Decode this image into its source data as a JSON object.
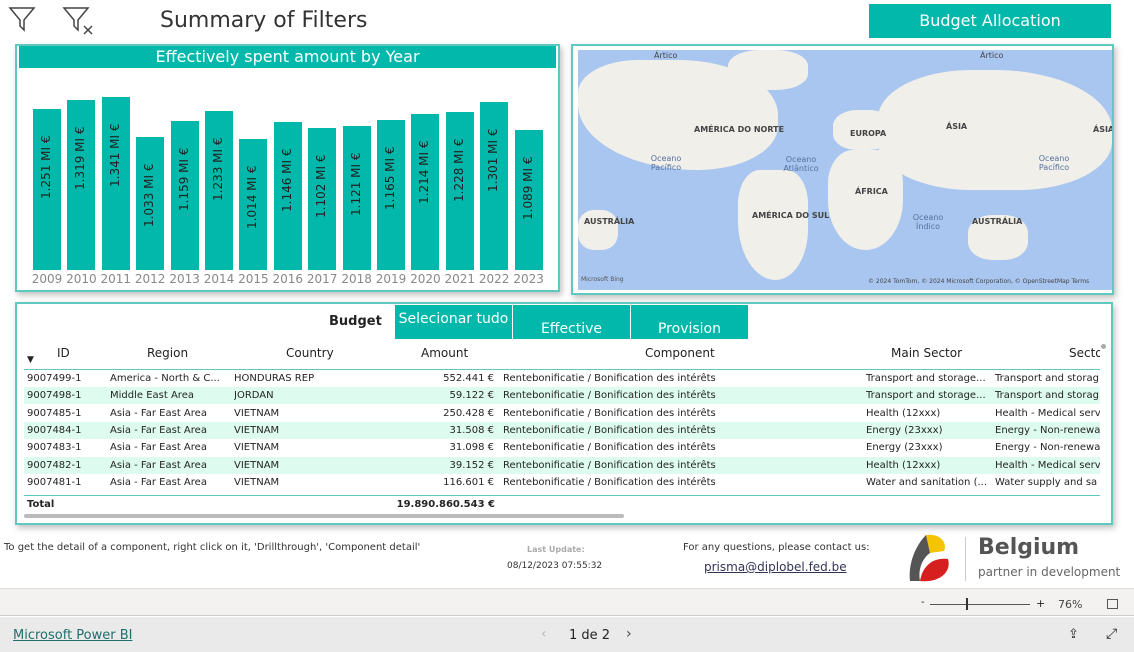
{
  "header": {
    "title": "Summary of Filters",
    "budget_allocation": "Budget Allocation",
    "filter_icon": "filter-icon",
    "clear_filter_icon": "clear-filter-icon"
  },
  "chart_data": {
    "type": "bar",
    "title": "Effectively spent amount by Year",
    "categories": [
      "2009",
      "2010",
      "2011",
      "2012",
      "2013",
      "2014",
      "2015",
      "2016",
      "2017",
      "2018",
      "2019",
      "2020",
      "2021",
      "2022",
      "2023"
    ],
    "values": [
      1.251,
      1.319,
      1.341,
      1.033,
      1.159,
      1.233,
      1.014,
      1.146,
      1.102,
      1.121,
      1.165,
      1.214,
      1.228,
      1.301,
      1.089
    ],
    "labels": [
      "1.251 MI €",
      "1.319 MI €",
      "1.341 MI €",
      "1.033 MI €",
      "1.159 MI €",
      "1.233 MI €",
      "1.014 MI €",
      "1.146 MI €",
      "1.102 MI €",
      "1.121 MI €",
      "1.165 MI €",
      "1.214 MI €",
      "1.228 MI €",
      "1.301 MI €",
      "1.089 MI €"
    ],
    "ylim": [
      0,
      1.35
    ],
    "color": "#01b8aa"
  },
  "map": {
    "labels": {
      "artico1": "Ártico",
      "artico2": "Ártico",
      "na": "AMÉRICA DO NORTE",
      "eu": "EUROPA",
      "asia1": "ÁSIA",
      "asia2": "ÁSIA",
      "af": "ÁFRICA",
      "sa": "AMÉRICA DO SUL",
      "au1": "AUSTRÁLIA",
      "au2": "AUSTRÁLIA",
      "pac1": "Oceano Pacífico",
      "pac2": "Oceano Pacífico",
      "atl": "Oceano Atlântico",
      "ind": "Oceano Índico"
    },
    "bing": "Microsoft Bing",
    "copyright": "© 2024 TomTom, © 2024 Microsoft Corporation, © OpenStreetMap  Terms"
  },
  "table": {
    "toggle_label": "Budget",
    "tabs": [
      "Selecionar tudo",
      "Effective",
      "Provision"
    ],
    "columns": [
      "ID",
      "Region",
      "Country",
      "Amount",
      "Component",
      "Main Sector",
      "Sector"
    ],
    "rows": [
      [
        "9007499-1",
        "America - North & C...",
        "HONDURAS REP",
        "552.441 €",
        "Rentebonificatie / Bonification des intérêts",
        "Transport and storage...",
        "Transport and storag"
      ],
      [
        "9007498-1",
        "Middle East Area",
        "JORDAN",
        "59.122 €",
        "Rentebonificatie / Bonification des intérêts",
        "Transport and storage...",
        "Transport and storag"
      ],
      [
        "9007485-1",
        "Asia - Far East Area",
        "VIETNAM",
        "250.428 €",
        "Rentebonificatie / Bonification des intérêts",
        "Health (12xxx)",
        "Health - Medical serv"
      ],
      [
        "9007484-1",
        "Asia - Far East Area",
        "VIETNAM",
        "31.508 €",
        "Rentebonificatie / Bonification des intérêts",
        "Energy (23xxx)",
        "Energy - Non-renewa"
      ],
      [
        "9007483-1",
        "Asia - Far East Area",
        "VIETNAM",
        "31.098 €",
        "Rentebonificatie / Bonification des intérêts",
        "Energy (23xxx)",
        "Energy - Non-renewa"
      ],
      [
        "9007482-1",
        "Asia - Far East Area",
        "VIETNAM",
        "39.152 €",
        "Rentebonificatie / Bonification des intérêts",
        "Health (12xxx)",
        "Health - Medical serv"
      ],
      [
        "9007481-1",
        "Asia - Far East Area",
        "VIETNAM",
        "116.601 €",
        "Rentebonificatie / Bonification des intérêts",
        "Water and sanitation (...",
        "Water supply and sa"
      ]
    ],
    "total_label": "Total",
    "total_amount": "19.890.860.543 €"
  },
  "footer": {
    "hint": "To get the detail of a component, right click on it, 'Drillthrough', 'Component detail'",
    "last_update_label": "Last Update:",
    "last_update": "08/12/2023 07:55:32",
    "contact": "For any questions, please contact us:",
    "email": "prisma@diplobel.fed.be",
    "logo_title": "Belgium",
    "logo_sub": "partner in development"
  },
  "statusbar": {
    "zoom": "76%",
    "minus": "-",
    "plus": "+"
  },
  "bottombar": {
    "brand": "Microsoft Power BI",
    "page": "1 de 2"
  }
}
